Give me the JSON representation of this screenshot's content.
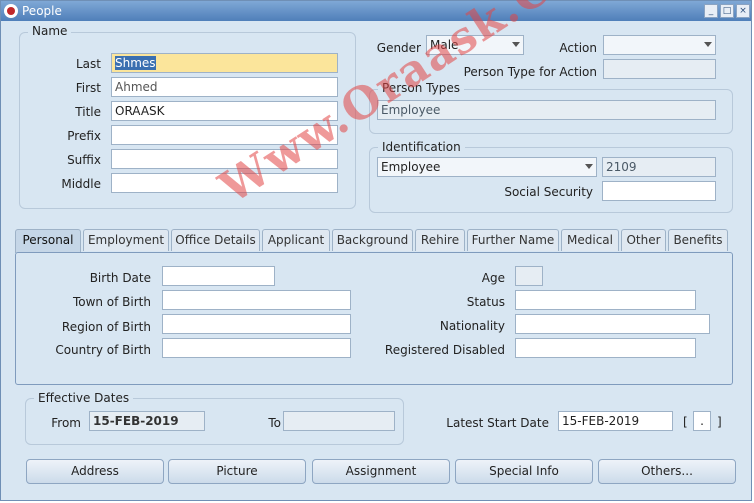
{
  "window": {
    "title": "People"
  },
  "name_group": {
    "legend": "Name",
    "last_label": "Last",
    "last_value": "Shmes",
    "first_label": "First",
    "first_value": "Ahmed",
    "title_label": "Title",
    "title_value": "ORAASK",
    "prefix_label": "Prefix",
    "prefix_value": "",
    "suffix_label": "Suffix",
    "suffix_value": "",
    "middle_label": "Middle",
    "middle_value": ""
  },
  "header_right": {
    "gender_label": "Gender",
    "gender_value": "Male",
    "action_label": "Action",
    "action_value": "",
    "person_type_action_label": "Person Type for Action",
    "person_type_action_value": ""
  },
  "person_types": {
    "legend": "Person Types",
    "value": "Employee"
  },
  "identification": {
    "legend": "Identification",
    "type_value": "Employee",
    "number_value": "2109",
    "ssn_label": "Social Security",
    "ssn_value": ""
  },
  "tabs": [
    {
      "label": "Personal",
      "active": true
    },
    {
      "label": "Employment"
    },
    {
      "label": "Office Details"
    },
    {
      "label": "Applicant"
    },
    {
      "label": "Background"
    },
    {
      "label": "Rehire"
    },
    {
      "label": "Further Name"
    },
    {
      "label": "Medical"
    },
    {
      "label": "Other"
    },
    {
      "label": "Benefits"
    }
  ],
  "personal": {
    "birth_date_label": "Birth Date",
    "birth_date_value": "",
    "town_label": "Town of Birth",
    "town_value": "",
    "region_label": "Region of Birth",
    "region_value": "",
    "country_label": "Country of Birth",
    "country_value": "",
    "age_label": "Age",
    "age_value": "",
    "status_label": "Status",
    "status_value": "",
    "nationality_label": "Nationality",
    "nationality_value": "",
    "disabled_label": "Registered Disabled",
    "disabled_value": ""
  },
  "effective_dates": {
    "legend": "Effective Dates",
    "from_label": "From",
    "from_value": "15-FEB-2019",
    "to_label": "To",
    "to_value": ""
  },
  "latest_start": {
    "label": "Latest Start Date",
    "value": "15-FEB-2019",
    "bracket_open": "[",
    "bracket_close": "]",
    "flex_value": "."
  },
  "buttons": {
    "address": "Address",
    "picture": "Picture",
    "assignment": "Assignment",
    "special_info": "Special Info",
    "others": "Others..."
  },
  "watermark": "Www.Oraask.Com"
}
